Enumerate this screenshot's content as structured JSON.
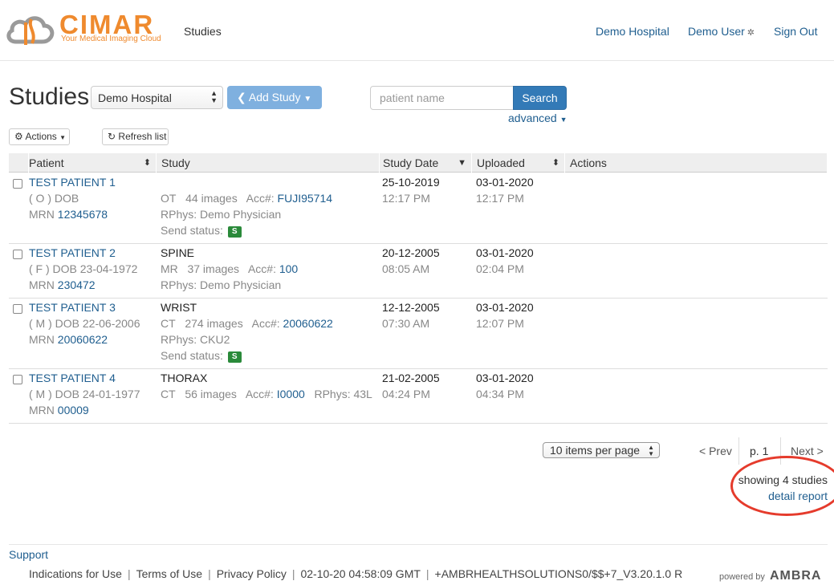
{
  "header": {
    "logo_word": "CIMAR",
    "logo_tagline": "Your Medical Imaging Cloud",
    "nav_studies": "Studies",
    "hospital": "Demo Hospital",
    "user": "Demo User",
    "signout": "Sign Out"
  },
  "toolbar": {
    "title": "Studies",
    "hospital_select": "Demo Hospital",
    "add_study": "Add Study",
    "search_placeholder": "patient name",
    "search_button": "Search",
    "advanced": "advanced",
    "actions": "Actions",
    "refresh": "Refresh list"
  },
  "table": {
    "headers": {
      "patient": "Patient",
      "study": "Study",
      "study_date": "Study Date",
      "uploaded": "Uploaded",
      "actions": "Actions"
    },
    "rows": [
      {
        "name": "TEST PATIENT 1",
        "demo": "( O ) DOB",
        "mrn_label": "MRN",
        "mrn": "12345678",
        "desc": "",
        "modality": "OT",
        "images": "44 images",
        "acc_label": "Acc#:",
        "acc": "FUJI95714",
        "rphys": "RPhys: Demo Physician",
        "send_status": "Send status:",
        "badge": "S",
        "study_date": "25-10-2019",
        "study_time": "12:17 PM",
        "upload_date": "03-01-2020",
        "upload_time": "12:17 PM"
      },
      {
        "name": "TEST PATIENT 2",
        "demo": "( F ) DOB 23-04-1972",
        "mrn_label": "MRN",
        "mrn": "230472",
        "desc": "SPINE",
        "modality": "MR",
        "images": "37 images",
        "acc_label": "Acc#:",
        "acc": "100",
        "rphys": "RPhys: Demo Physician",
        "study_date": "20-12-2005",
        "study_time": "08:05 AM",
        "upload_date": "03-01-2020",
        "upload_time": "02:04 PM"
      },
      {
        "name": "TEST PATIENT 3",
        "demo": "( M ) DOB 22-06-2006",
        "mrn_label": "MRN",
        "mrn": "20060622",
        "desc": "WRIST",
        "modality": "CT",
        "images": "274 images",
        "acc_label": "Acc#:",
        "acc": "20060622",
        "rphys": "RPhys: CKU2",
        "send_status": "Send status:",
        "badge": "S",
        "study_date": "12-12-2005",
        "study_time": "07:30 AM",
        "upload_date": "03-01-2020",
        "upload_time": "12:07 PM"
      },
      {
        "name": "TEST PATIENT 4",
        "demo": "( M ) DOB 24-01-1977",
        "mrn_label": "MRN",
        "mrn": "00009",
        "desc": "THORAX",
        "modality": "CT",
        "images": "56 images",
        "acc_label": "Acc#:",
        "acc": "I0000",
        "rphys": "RPhys: 43L",
        "study_date": "21-02-2005",
        "study_time": "04:24 PM",
        "upload_date": "03-01-2020",
        "upload_time": "04:34 PM"
      }
    ]
  },
  "pagination": {
    "per_page": "10 items per page",
    "prev": "< Prev",
    "page": "p. 1",
    "next": "Next >",
    "showing": "showing 4 studies",
    "detail_report": "detail report"
  },
  "footer": {
    "support": "Support",
    "links": [
      "Indications for Use",
      "Terms of Use",
      "Privacy Policy"
    ],
    "timestamp": "02-10-20 04:58:09 GMT",
    "version": "+AMBRHEALTHSOLUTIONS0/$$+7_V3.20.1.0 R",
    "powered_by": "powered by",
    "brand": "AMBRA"
  },
  "colors": {
    "accent": "#337ab7",
    "link": "#1f5e8f",
    "logo": "#ef8a2e",
    "badge": "#2a8a3a",
    "highlight": "#e53b2c"
  }
}
